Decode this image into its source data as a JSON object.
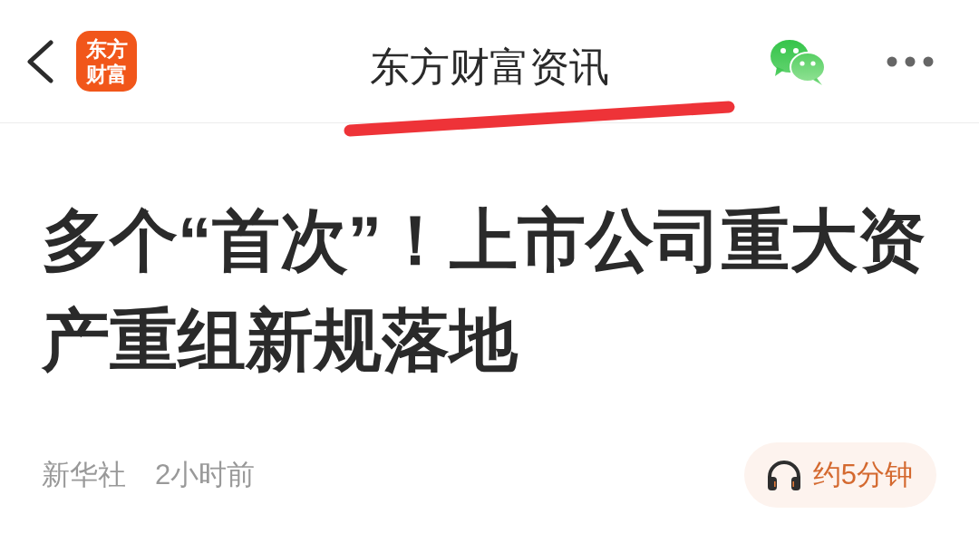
{
  "header": {
    "logo": {
      "lines": [
        "东方",
        "财富"
      ]
    },
    "title": "东方财富资讯"
  },
  "article": {
    "headline": "多个“首次”！上市公司重大资产重组新规落地",
    "source": "新华社",
    "time": "2小时前",
    "listen": {
      "label": "约5分钟"
    }
  }
}
